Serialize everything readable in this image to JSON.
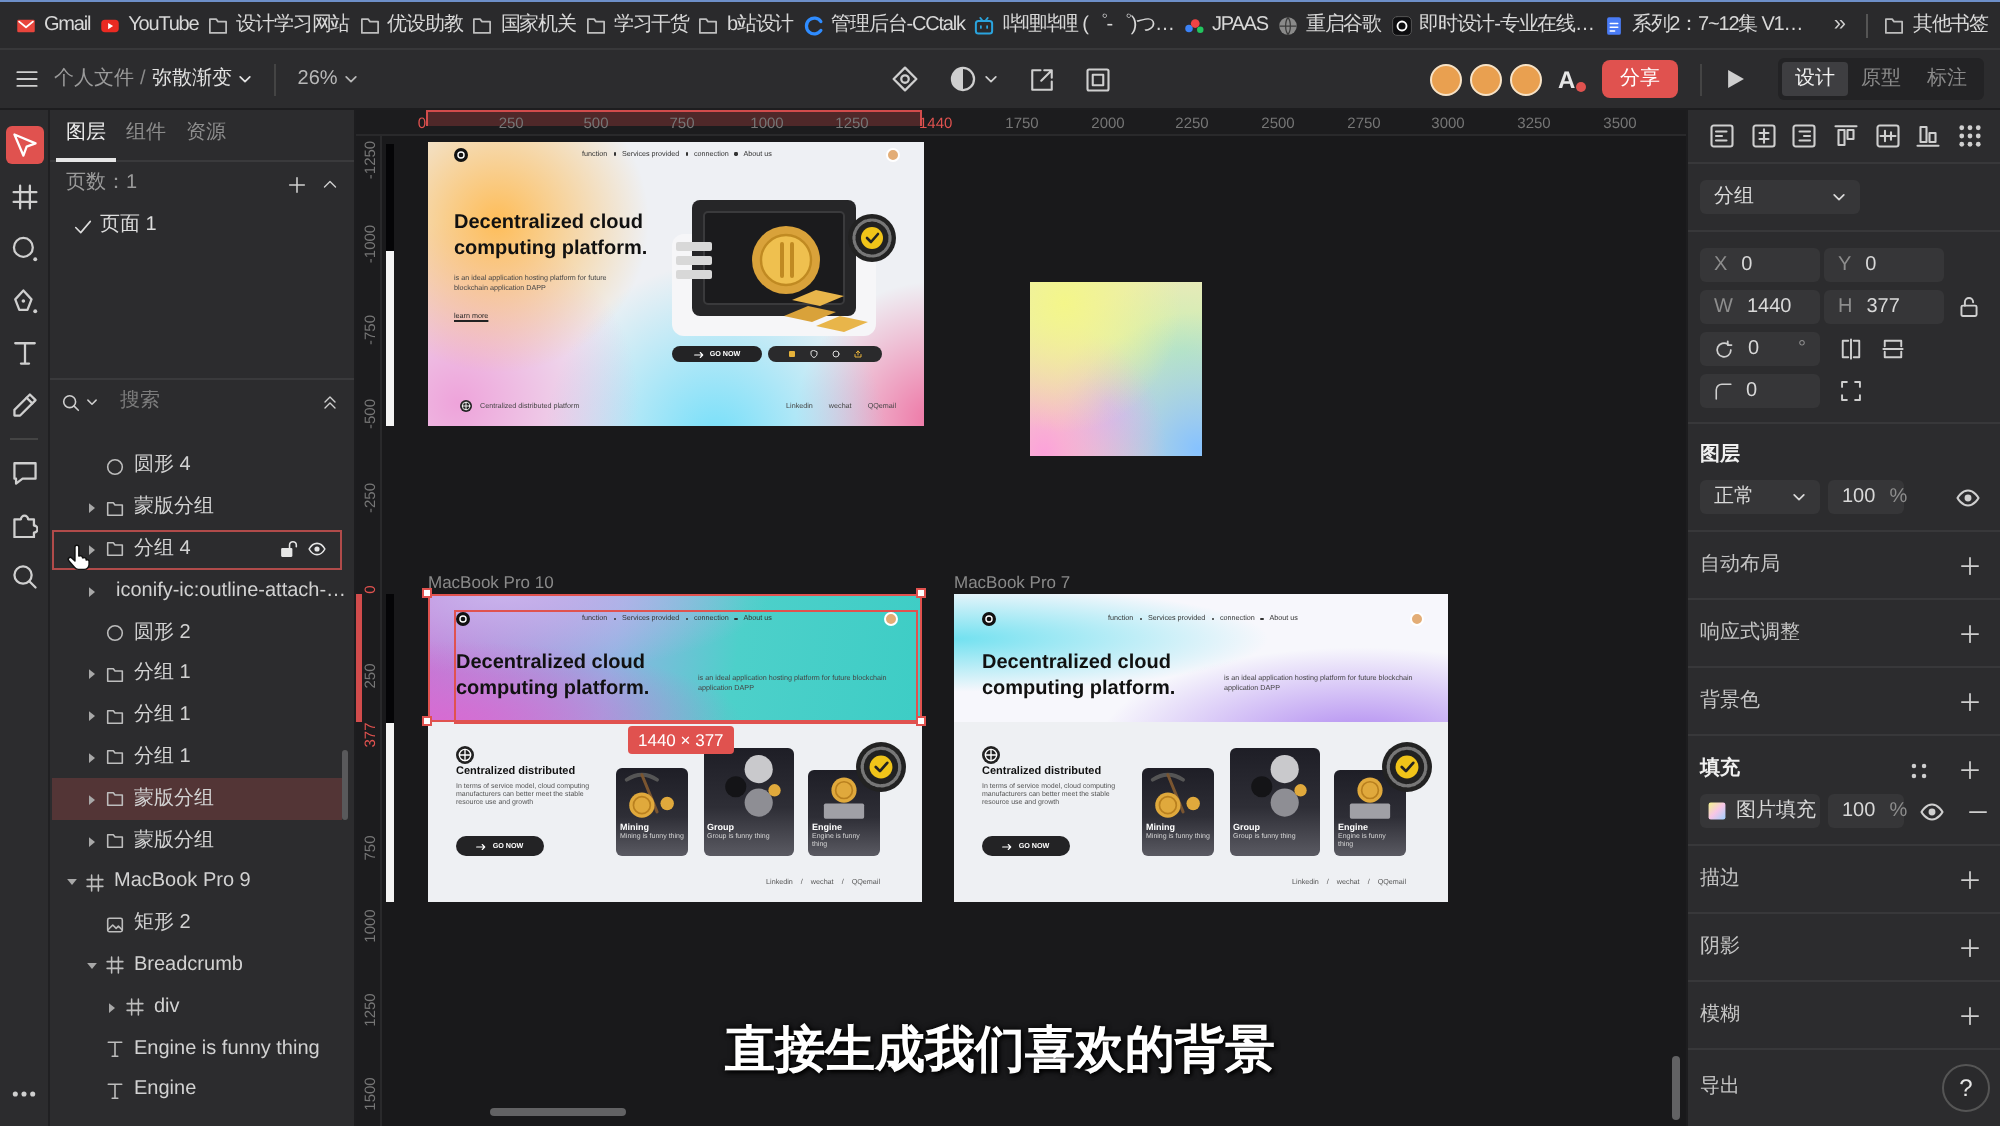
{
  "bookmarks": [
    {
      "kind": "gmail",
      "label": "Gmail"
    },
    {
      "kind": "youtube",
      "label": "YouTube"
    },
    {
      "kind": "folder",
      "label": "设计学习网站"
    },
    {
      "kind": "folder",
      "label": "优设助教"
    },
    {
      "kind": "folder",
      "label": "国家机关"
    },
    {
      "kind": "folder",
      "label": "学习干货"
    },
    {
      "kind": "folder",
      "label": "b站设计"
    },
    {
      "kind": "cctalk",
      "label": "管理后台-CCtalk"
    },
    {
      "kind": "bilibili",
      "label": "哔哩哔哩 (゜-゜)つ…"
    },
    {
      "kind": "jpaas",
      "label": "JPAAS"
    },
    {
      "kind": "globe",
      "label": "重启谷歌"
    },
    {
      "kind": "jsdesign",
      "label": "即时设计-专业在线…"
    },
    {
      "kind": "doc",
      "label": "系列2：7~12集 V1…"
    }
  ],
  "bookmarks_more": "»",
  "other_bookmarks": {
    "kind": "folder",
    "label": "其他书签"
  },
  "toolbar": {
    "breadcrumb": {
      "parent": "个人文件",
      "separator": "/",
      "current": "弥散渐变"
    },
    "zoom": "26%",
    "font_icon": "A",
    "share": "分享",
    "modes": [
      {
        "label": "设计",
        "selected": true
      },
      {
        "label": "原型",
        "selected": false
      },
      {
        "label": "标注",
        "selected": false
      }
    ]
  },
  "tool_groups": [
    [
      {
        "kind": "select",
        "selected": true
      },
      {
        "kind": "frame",
        "selected": false
      },
      {
        "kind": "ellipse",
        "selected": false
      },
      {
        "kind": "pen",
        "selected": false
      },
      {
        "kind": "text",
        "selected": false
      },
      {
        "kind": "pencil",
        "selected": false
      }
    ],
    [
      {
        "kind": "comment",
        "selected": false
      },
      {
        "kind": "plugin",
        "selected": false
      },
      {
        "kind": "search",
        "selected": false
      }
    ]
  ],
  "layers_panel": {
    "tabs": [
      {
        "label": "图层",
        "selected": true
      },
      {
        "label": "组件",
        "selected": false
      },
      {
        "label": "资源",
        "selected": false
      }
    ],
    "pages_title": "页数：1",
    "pages": [
      {
        "label": "页面 1",
        "selected": true
      }
    ],
    "search_placeholder": "搜索",
    "layers": [
      {
        "children": [
          {
            "kind": "ellipse",
            "label": "圆形 4",
            "selected": false,
            "hovered": false
          },
          {
            "kind": "group",
            "label": "蒙版分组",
            "expanded": false,
            "selected": false,
            "hovered": false
          },
          {
            "kind": "group",
            "label": "分组 4",
            "expanded": false,
            "selected": false,
            "hovered": true
          },
          {
            "kind": "frame",
            "label": "iconify-ic:outline-attach-…",
            "expanded": false,
            "selected": false,
            "hovered": false
          },
          {
            "kind": "ellipse",
            "label": "圆形 2",
            "selected": false,
            "hovered": false
          },
          {
            "kind": "group",
            "label": "分组 1",
            "expanded": false,
            "selected": false,
            "hovered": false
          },
          {
            "kind": "group",
            "label": "分组 1",
            "expanded": false,
            "selected": false,
            "hovered": false
          },
          {
            "kind": "group",
            "label": "分组 1",
            "expanded": false,
            "selected": false,
            "hovered": false
          },
          {
            "kind": "group",
            "label": "蒙版分组",
            "expanded": false,
            "selected": true,
            "hovered": false
          },
          {
            "kind": "group",
            "label": "蒙版分组",
            "expanded": false,
            "selected": false,
            "hovered": false
          }
        ]
      },
      {
        "kind": "frame",
        "label": "MacBook Pro 9",
        "expanded": true,
        "selected": false,
        "hovered": false,
        "children": [
          {
            "kind": "image",
            "label": "矩形 2",
            "selected": false,
            "hovered": false
          },
          {
            "kind": "frame",
            "label": "Breadcrumb",
            "expanded": true,
            "selected": false,
            "hovered": false,
            "children": [
              {
                "kind": "frame",
                "label": "div",
                "expanded": false,
                "selected": false,
                "hovered": false
              }
            ]
          },
          {
            "kind": "text",
            "label": "Engine is funny thing",
            "selected": false,
            "hovered": false
          },
          {
            "kind": "text",
            "label": "Engine",
            "selected": false,
            "hovered": false
          }
        ]
      }
    ]
  },
  "canvas": {
    "ruler_x": [
      {
        "label": "0",
        "highlighted": true
      },
      {
        "label": "250",
        "highlighted": false
      },
      {
        "label": "500",
        "highlighted": false
      },
      {
        "label": "750",
        "highlighted": false
      },
      {
        "label": "1000",
        "highlighted": false
      },
      {
        "label": "1250",
        "highlighted": false
      },
      {
        "label": "1440",
        "highlighted": true
      },
      {
        "label": "1750",
        "highlighted": false
      },
      {
        "label": "2000",
        "highlighted": false
      },
      {
        "label": "2250",
        "highlighted": false
      },
      {
        "label": "2500",
        "highlighted": false
      },
      {
        "label": "2750",
        "highlighted": false
      },
      {
        "label": "3000",
        "highlighted": false
      },
      {
        "label": "3250",
        "highlighted": false
      },
      {
        "label": "3500",
        "highlighted": false
      }
    ],
    "ruler_y": [
      {
        "label": "-1250",
        "highlighted": false
      },
      {
        "label": "-1000",
        "highlighted": false
      },
      {
        "label": "-750",
        "highlighted": false
      },
      {
        "label": "-500",
        "highlighted": false
      },
      {
        "label": "-250",
        "highlighted": false
      },
      {
        "label": "0",
        "highlighted": true
      },
      {
        "label": "250",
        "highlighted": false
      },
      {
        "label": "377",
        "highlighted": true
      },
      {
        "label": "750",
        "highlighted": false
      },
      {
        "label": "1000",
        "highlighted": false
      },
      {
        "label": "1250",
        "highlighted": false
      },
      {
        "label": "1500",
        "highlighted": false
      }
    ],
    "artboards": [
      {
        "kind": "hero",
        "selected": false,
        "nav": [
          "function",
          "Services provided",
          "connection",
          "About us"
        ],
        "heading": "Decentralized cloud computing platform.",
        "description": "is an ideal application hosting platform for future blockchain application DAPP",
        "link": "learn more",
        "button": "GO NOW",
        "footer_text": "Centralized distributed platform",
        "footer_links": [
          "Linkedin",
          "wechat",
          "QQemail"
        ]
      },
      {
        "kind": "gradient",
        "selected": false
      },
      {
        "kind": "landing",
        "name": "MacBook Pro 10",
        "selected": true,
        "size_label": "1440 × 377",
        "nav": [
          "function",
          "Services provided",
          "connection",
          "About us"
        ],
        "heading": "Decentralized cloud computing platform.",
        "description": "is an ideal application hosting platform for future blockchain application DAPP",
        "section_title": "Centralized distributed",
        "section_text": "In terms of service model, cloud computing manufacturers can better meet the stable resource use and growth",
        "button": "GO NOW",
        "cards": [
          {
            "title": "Mining",
            "text": "Mining is funny thing"
          },
          {
            "title": "Group",
            "text": "Group is funny thing"
          },
          {
            "title": "Engine",
            "text": "Engine is funny thing"
          }
        ],
        "footer_links": [
          "Linkedin",
          "wechat",
          "QQemail"
        ],
        "link_separator": "/"
      },
      {
        "kind": "landing",
        "name": "MacBook Pro 7",
        "selected": false,
        "nav": [
          "function",
          "Services provided",
          "connection",
          "About us"
        ],
        "heading": "Decentralized cloud computing platform.",
        "description": "is an ideal application hosting platform for future blockchain application DAPP",
        "section_title": "Centralized distributed",
        "section_text": "In terms of service model, cloud computing manufacturers can better meet the stable resource use and growth",
        "button": "GO NOW",
        "cards": [
          {
            "title": "Mining",
            "text": "Mining is funny thing"
          },
          {
            "title": "Group",
            "text": "Group is funny thing"
          },
          {
            "title": "Engine",
            "text": "Engine is funny thing"
          }
        ],
        "footer_links": [
          "Linkedin",
          "wechat",
          "QQemail"
        ],
        "link_separator": "/"
      }
    ],
    "subtitle": "直接生成我们喜欢的背景"
  },
  "inspector": {
    "layer_type": "分组",
    "geometry": [
      {
        "label": "X",
        "value": "0"
      },
      {
        "label": "Y",
        "value": "0"
      },
      {
        "label": "W",
        "value": "1440"
      },
      {
        "label": "H",
        "value": "377"
      }
    ],
    "rotation": {
      "value": "0",
      "unit": "°"
    },
    "radius": {
      "value": "0"
    },
    "layer": {
      "title": "图层",
      "blend": "正常",
      "opacity": "100",
      "unit": "%"
    },
    "sections": [
      {
        "kind": "plain",
        "title": "自动布局"
      },
      {
        "kind": "plain",
        "title": "响应式调整"
      },
      {
        "kind": "plain",
        "title": "背景色"
      },
      {
        "kind": "fill",
        "title": "填充",
        "fills": [
          {
            "label": "图片填充",
            "opacity": "100",
            "unit": "%"
          }
        ]
      },
      {
        "kind": "plain",
        "title": "描边"
      },
      {
        "kind": "plain",
        "title": "阴影"
      },
      {
        "kind": "plain",
        "title": "模糊"
      },
      {
        "kind": "export",
        "title": "导出",
        "help": "?"
      }
    ]
  }
}
